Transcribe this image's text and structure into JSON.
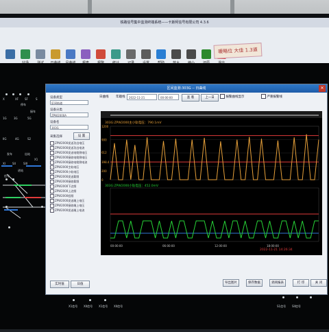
{
  "window_title": "铁路信号集中监测终端系统——卡斯柯信号有限公司 4.3.6",
  "toolbar": [
    {
      "label": "",
      "icon": "logo-icon",
      "color": "#3b6ea5"
    },
    {
      "label": "站场",
      "icon": "station-icon",
      "color": "#2f8f4e"
    },
    {
      "label": "测试",
      "icon": "test-icon",
      "color": "#7a8ba0"
    },
    {
      "label": "日曲线",
      "icon": "day-curve-icon",
      "color": "#c99a2e"
    },
    {
      "label": "月曲线",
      "icon": "month-curve-icon",
      "color": "#4a79c4"
    },
    {
      "label": "报表",
      "icon": "report-icon",
      "color": "#8b5fbf"
    },
    {
      "label": "报警",
      "icon": "alarm-icon",
      "color": "#d04a3a"
    },
    {
      "label": "统计",
      "icon": "stats-icon",
      "color": "#3a9a8a"
    },
    {
      "label": "记录",
      "icon": "record-icon",
      "color": "#6a6a6a"
    },
    {
      "label": "设置",
      "icon": "settings-icon",
      "color": "#5c5c5c"
    },
    {
      "label": "帮助",
      "icon": "help-icon",
      "color": "#2a7fd4"
    },
    {
      "label": "放大",
      "icon": "zoom-in-icon",
      "color": "#4a4a4a"
    },
    {
      "label": "缩小",
      "icon": "zoom-out-icon",
      "color": "#4a4a4a"
    },
    {
      "label": "还原",
      "icon": "restore-icon",
      "color": "#2c8a2c"
    },
    {
      "label": "退出",
      "icon": "exit-icon",
      "color": "#d23a3a"
    }
  ],
  "sticky_note": "暖略位 大佳 1.3道",
  "dialog": {
    "title": "区间监测:303G -- 日曲线",
    "controls": {
      "day_curve_label": "日曲线",
      "date_label": "年趣线",
      "date_value": "2022-11-21",
      "time_value": "00:00:00",
      "query_button": "查 看",
      "prev_button": "上一日",
      "check_alarm": "报警曲线显示",
      "check_strict": "严重报警线"
    },
    "left_panel": {
      "device_type_label": "设备类型",
      "device_type_value": "区间轨道",
      "device_group_label": "设备分类",
      "device_group_value": "ZPW2000A",
      "device_name_label": "设备名",
      "device_name_value": "303G",
      "item_select_label": "采集选择",
      "set_button": "设 置",
      "items": [
        {
          "label": "ZPW2000发送功出电压",
          "checked": false
        },
        {
          "label": "ZPW2000发送功出电流",
          "checked": false
        },
        {
          "label": "ZPW2000发送电缆侧电压",
          "checked": false
        },
        {
          "label": "ZPW2000接收电缆侧电压",
          "checked": false
        },
        {
          "label": "ZPW2000接收电缆侧电流",
          "checked": false
        },
        {
          "label": "ZPW2000主轨电压",
          "checked": true
        },
        {
          "label": "ZPW2000小轨电压",
          "checked": true
        },
        {
          "label": "ZPW2000发送载频",
          "checked": false
        },
        {
          "label": "ZPW2000接收载频",
          "checked": false
        },
        {
          "label": "ZPW2000下边频",
          "checked": false
        },
        {
          "label": "ZPW2000上边频",
          "checked": false
        },
        {
          "label": "ZPW2000低频",
          "checked": false
        },
        {
          "label": "ZPW2000发送端上电压",
          "checked": false
        },
        {
          "label": "ZPW2000接收端上电压",
          "checked": false
        },
        {
          "label": "ZPW2000发送端上电流",
          "checked": false
        }
      ],
      "realtime_button": "实时值",
      "day_value_button": "日值"
    },
    "bottom_buttons": [
      "导出图片",
      "保存数据",
      "调阅报表",
      "打 印",
      "关 闭"
    ]
  },
  "chart_data": [
    {
      "type": "line",
      "title": "303G:ZPW2000主小轨电压：790.1mV",
      "y_tick_labels": [
        "1200",
        "900",
        "612",
        "398.4",
        "200",
        "0"
      ],
      "ylim": [
        0,
        1200
      ],
      "alarm_line": 398.4,
      "upper_line": 990,
      "color": "#e8a13a",
      "series": [
        {
          "values": [
            0,
            820,
            0,
            0,
            900,
            0,
            780,
            0,
            0,
            950,
            0,
            0,
            0,
            870,
            0,
            0,
            920,
            0,
            0,
            0,
            900,
            0,
            0,
            940,
            0,
            0,
            0,
            860,
            0,
            0,
            0,
            900,
            0,
            0,
            960,
            0,
            0,
            920,
            0,
            0,
            0,
            880,
            0,
            0,
            0,
            950,
            0,
            0,
            1020,
            0,
            0,
            900
          ]
        }
      ]
    },
    {
      "type": "line",
      "title": "303G:ZPW2000小轨电压：452.0mV",
      "color": "#27d437",
      "series": [
        {
          "values": [
            0,
            0,
            1,
            1,
            0,
            1,
            0,
            0,
            1,
            1,
            1,
            0,
            1,
            0,
            0,
            1,
            0,
            1,
            1,
            0,
            0,
            1,
            1,
            1,
            0,
            1,
            0,
            0,
            1,
            0,
            1,
            1,
            0,
            1,
            0,
            0,
            1,
            1,
            0,
            1,
            0,
            0,
            1,
            1,
            0,
            1,
            0,
            1,
            0,
            0,
            1,
            1
          ]
        }
      ]
    }
  ],
  "chart_bottom": {
    "x_labels": [
      "00:00:00",
      "06:00:00",
      "12:00:00",
      "18:00:00"
    ],
    "date_text": "2022-11-21 14:26:34"
  },
  "schematic": {
    "labels": [
      "X",
      "XF",
      "SF",
      "S",
      "1G",
      "3G",
      "5G",
      "IIG",
      "4G",
      "S2",
      "X1",
      "XI",
      "SII",
      "SIII",
      "停车",
      "接车",
      "发车",
      "出站",
      "进站",
      "信号"
    ],
    "bottom_labels": [
      "X1信号",
      "XII信号",
      "X1信号",
      "XII信号",
      "S1信号",
      "SII信号"
    ]
  }
}
